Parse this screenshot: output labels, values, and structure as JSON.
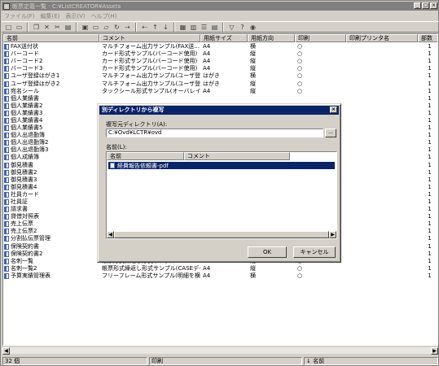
{
  "window": {
    "title": "帳票定義一覧 - C:¥ListCREATOR¥Assets",
    "minimize": "_",
    "maximize": "□",
    "close": "×"
  },
  "menu": [
    "ファイル(F)",
    "編集(E)",
    "表示(V)",
    "ヘルプ(H)"
  ],
  "toolbar_icons": [
    "new-doc-icon",
    "open-icon",
    "copy-icon",
    "delete-icon",
    "cut-icon",
    "paste-icon",
    "properties-icon",
    "folder-icon",
    "folder-open-icon",
    "refresh-icon",
    "export-icon",
    "import-icon",
    "up-icon",
    "down-icon",
    "large-icons-icon",
    "small-icons-icon",
    "list-view-icon",
    "details-view-icon",
    "filter-icon",
    "help-icon",
    "about-icon"
  ],
  "columns": [
    "名前",
    "コメント",
    "用紙サイズ",
    "用紙方向",
    "印刷",
    "印刷プリンタ名",
    "部数"
  ],
  "rows": [
    [
      "FAX送付状",
      "マルチフォーム出力サンプル(FAX送...",
      "A4",
      "横",
      "○",
      "",
      "1"
    ],
    [
      "バーコード",
      "カード形式サンプル(バーコード使用)",
      "A4",
      "縦",
      "○",
      "",
      "1"
    ],
    [
      "バーコード2",
      "カード形式サンプル(バーコード使用)",
      "A4",
      "縦",
      "○",
      "",
      "1"
    ],
    [
      "バーコード3",
      "カード形式サンプル(バーコード使用)",
      "A4",
      "縦",
      "○",
      "",
      "1"
    ],
    [
      "ユーザ登録はがき1",
      "マルチフォーム出力サンプル(ユーザ登...",
      "はがき",
      "横",
      "○",
      "",
      "1"
    ],
    [
      "ユーザ登録はがき2",
      "マルチフォーム出力サンプル(ユーザ登...",
      "はがき",
      "縦",
      "○",
      "",
      "1"
    ],
    [
      "宛名シール",
      "タックシール形式サンプル(オーバレイを...",
      "A4",
      "縦",
      "○",
      "",
      "1"
    ],
    [
      "個人業績書",
      "",
      "",
      "",
      "",
      "",
      "1"
    ],
    [
      "個人業績書2",
      "",
      "",
      "",
      "",
      "",
      "1"
    ],
    [
      "個人業績書3",
      "",
      "",
      "",
      "",
      "",
      "1"
    ],
    [
      "個人業績書4",
      "",
      "",
      "",
      "",
      "",
      "1"
    ],
    [
      "個人業績書5",
      "",
      "",
      "",
      "",
      "",
      "1"
    ],
    [
      "個人出退勤簿",
      "",
      "",
      "",
      "",
      "",
      "1"
    ],
    [
      "個人出退勤簿2",
      "",
      "",
      "",
      "",
      "",
      "1"
    ],
    [
      "個人出退勤簿3",
      "",
      "",
      "",
      "",
      "",
      "1"
    ],
    [
      "個人成績簿",
      "",
      "",
      "",
      "",
      "",
      "1"
    ],
    [
      "御見積書",
      "",
      "",
      "",
      "",
      "",
      "1"
    ],
    [
      "御見積書2",
      "",
      "",
      "",
      "",
      "",
      "1"
    ],
    [
      "御見積書3",
      "",
      "",
      "",
      "",
      "",
      "1"
    ],
    [
      "御見積書4",
      "",
      "",
      "",
      "",
      "",
      "1"
    ],
    [
      "社員カード",
      "",
      "",
      "",
      "",
      "",
      "1"
    ],
    [
      "社員証",
      "",
      "",
      "",
      "",
      "",
      "1"
    ],
    [
      "請求書",
      "",
      "",
      "",
      "",
      "",
      "1"
    ],
    [
      "貸借対照表",
      "",
      "",
      "",
      "",
      "",
      "1"
    ],
    [
      "売上伝票",
      "",
      "",
      "",
      "",
      "",
      "1"
    ],
    [
      "売上伝票2",
      "",
      "",
      "",
      "",
      "",
      "1"
    ],
    [
      "分割払伝票管理",
      "",
      "A4",
      "",
      "",
      "",
      "1"
    ],
    [
      "保険契約書",
      "カード形式サンプル(多領域のオーバレイ...",
      "A4",
      "縦",
      "○",
      "",
      "1"
    ],
    [
      "保険契約書2",
      "カード形式サンプル(CASEデータ出力...",
      "A4",
      "縦",
      "○",
      "",
      "1"
    ],
    [
      "名刺一覧",
      "帳票形式繰返し形式サンプル",
      "A4",
      "縦",
      "○",
      "",
      "1"
    ],
    [
      "名刺一覧2",
      "帳票形式繰返し形式サンプル(CASEデー...",
      "A4",
      "縦",
      "○",
      "",
      "1"
    ],
    [
      "予算実績管理表",
      "フリーフレーム形式サンプル(明細を横...",
      "A4",
      "横",
      "○",
      "",
      "1"
    ]
  ],
  "status": {
    "count": "32 個",
    "mode": "印刷",
    "sort": "↓ 名前"
  },
  "dialog": {
    "title": "別ディレクトリから複写",
    "close": "×",
    "source_label": "複写元ディレクトリ(A):",
    "source_value": "C:¥Ovd¥LCTR¥ovd",
    "browse": "...",
    "names_label": "名前(L):",
    "list_columns": [
      "名前",
      "コメント"
    ],
    "selected_item": "経費報告依頼書-pdf",
    "ok": "OK",
    "cancel": "キャンセル"
  }
}
